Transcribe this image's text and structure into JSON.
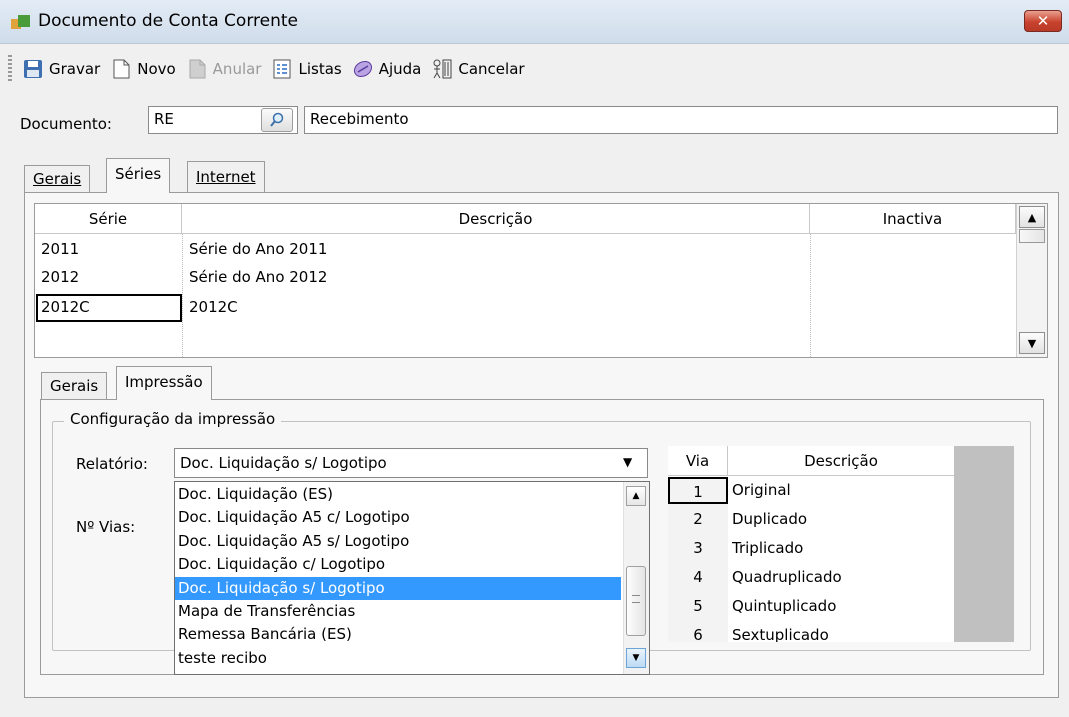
{
  "window": {
    "title": "Documento de Conta Corrente",
    "close_glyph": "✕"
  },
  "toolbar": [
    {
      "label": "Gravar",
      "icon": "save-icon",
      "disabled": false
    },
    {
      "label": "Novo",
      "icon": "new-document-icon",
      "disabled": false
    },
    {
      "label": "Anular",
      "icon": "cancel-document-icon",
      "disabled": true
    },
    {
      "label": "Listas",
      "icon": "list-icon",
      "disabled": false
    },
    {
      "label": "Ajuda",
      "icon": "help-icon",
      "disabled": false
    },
    {
      "label": "Cancelar",
      "icon": "exit-icon",
      "disabled": false
    }
  ],
  "document": {
    "label": "Documento:",
    "code": "RE",
    "description": "Recebimento"
  },
  "main_tabs": {
    "gerais": "Gerais",
    "series": "Séries",
    "internet": "Internet"
  },
  "series_grid": {
    "headers": {
      "serie": "Série",
      "descricao": "Descrição",
      "inactiva": "Inactiva"
    },
    "rows": [
      {
        "serie": "2011",
        "descricao": "Série do Ano 2011"
      },
      {
        "serie": "2012",
        "descricao": "Série do Ano 2012"
      },
      {
        "serie": "2012C",
        "descricao": "2012C"
      }
    ]
  },
  "sub_tabs": {
    "gerais": "Gerais",
    "impressao": "Impressão"
  },
  "print_config": {
    "group_title": "Configuração da impressão",
    "relatorio_label": "Relatório:",
    "selected_report": "Doc. Liquidação s/ Logotipo",
    "vias_label": "Nº Vias:",
    "report_options": [
      "Doc. Liquidação (ES)",
      "Doc. Liquidação A5 c/ Logotipo",
      "Doc. Liquidação A5 s/ Logotipo",
      "Doc. Liquidação c/ Logotipo",
      "Doc. Liquidação s/ Logotipo",
      "Mapa de Transferências",
      "Remessa Bancária (ES)",
      "teste recibo"
    ],
    "selected_index": 4
  },
  "vias_grid": {
    "headers": {
      "via": "Via",
      "descricao": "Descrição"
    },
    "rows": [
      {
        "via": "1",
        "descricao": "Original"
      },
      {
        "via": "2",
        "descricao": "Duplicado"
      },
      {
        "via": "3",
        "descricao": "Triplicado"
      },
      {
        "via": "4",
        "descricao": "Quadruplicado"
      },
      {
        "via": "5",
        "descricao": "Quintuplicado"
      },
      {
        "via": "6",
        "descricao": "Sextuplicado"
      }
    ]
  }
}
